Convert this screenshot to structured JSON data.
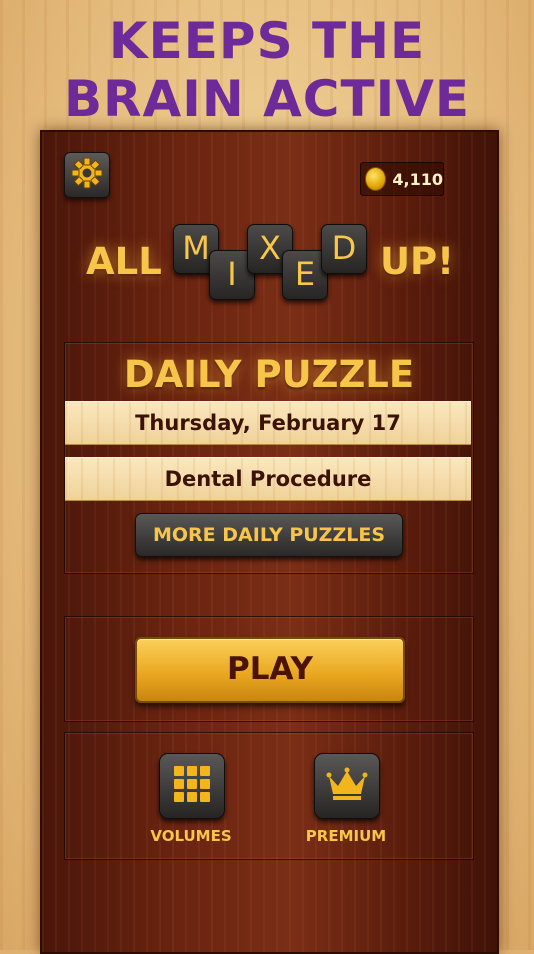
{
  "headline": {
    "line1": "KEEPS THE",
    "line2": "BRAIN ACTIVE"
  },
  "header": {
    "coins": "4,110"
  },
  "logo": {
    "word_left": "ALL",
    "word_right": "UP!",
    "tiles": [
      "M",
      "I",
      "X",
      "E",
      "D"
    ]
  },
  "daily": {
    "title": "DAILY PUZZLE",
    "date": "Thursday, February 17",
    "puzzle_name": "Dental Procedure",
    "more_label": "MORE DAILY PUZZLES"
  },
  "play": {
    "label": "PLAY"
  },
  "bottom": {
    "volumes_label": "VOLUMES",
    "premium_label": "PREMIUM"
  },
  "colors": {
    "gold": "#f6c54a",
    "purple": "#6f2a9a",
    "wood_dark": "#5a1c0c"
  }
}
